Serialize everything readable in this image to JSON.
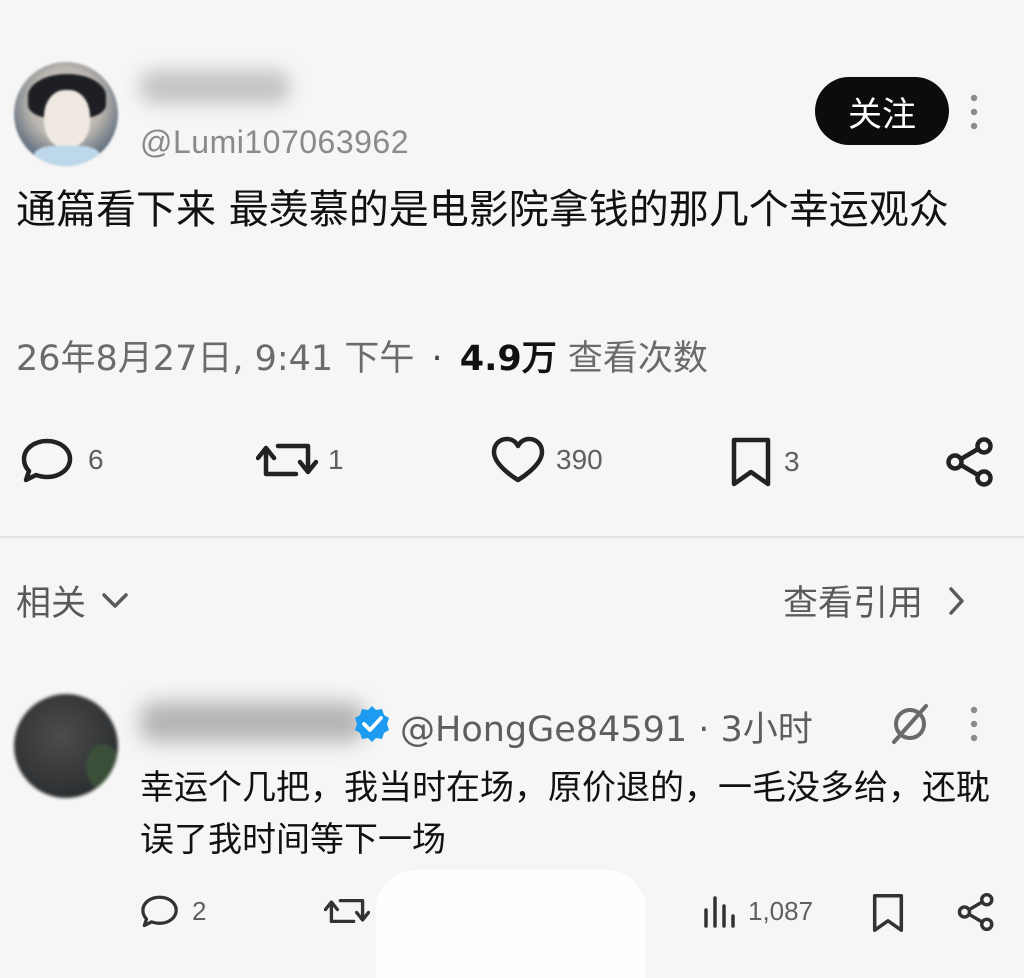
{
  "post": {
    "handle": "@Lumi107063962",
    "follow_label": "关注",
    "text": "通篇看下来 最羡慕的是电影院拿钱的那几个幸运观众",
    "timestamp": "26年8月27日, 9:41 下午",
    "separator": "·",
    "views_count": "4.9万",
    "views_label": "查看次数",
    "actions": {
      "replies": "6",
      "reposts": "1",
      "likes": "390",
      "bookmarks": "3"
    }
  },
  "related": {
    "label": "相关",
    "view_quotes_label": "查看引用"
  },
  "reply": {
    "handle_time": "@HongGe84591 · 3小时",
    "text": "幸运个几把，我当时在场，原价退的，一毛没多给，还耽误了我时间等下一场",
    "actions": {
      "replies": "2",
      "views": "1,087"
    }
  },
  "colors": {
    "background": "#f6f6f6",
    "follow_button": "#0c0c0c",
    "verified_badge": "#1d9bf0",
    "muted_text": "#6b6b6b"
  },
  "icons": {
    "reply": "speech-bubble-icon",
    "repost": "repost-arrows-icon",
    "like": "heart-icon",
    "bookmark": "bookmark-icon",
    "share": "share-icon",
    "views": "bar-chart-icon",
    "more": "kebab-icon",
    "verified": "verified-badge-icon",
    "grok": "grok-icon",
    "chevron_down": "chevron-down-icon",
    "chevron_right": "chevron-right-icon"
  }
}
